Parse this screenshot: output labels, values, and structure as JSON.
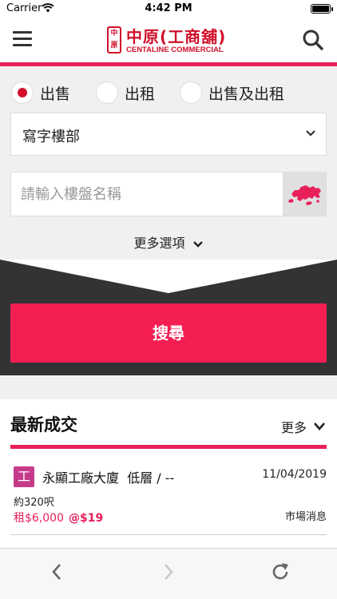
{
  "status_bar": {
    "carrier": "Carrier",
    "time": "4:42 PM"
  },
  "header": {
    "logo_seal": "中原",
    "logo_name_zh": "中原(工商舖)",
    "logo_name_en": "CENTALINE COMMERCIAL",
    "menu_icon": "hamburger-icon",
    "search_icon": "magnifier-icon",
    "accent_color": "#e8205a"
  },
  "search_form": {
    "radios": [
      {
        "label": "出售",
        "checked": true
      },
      {
        "label": "出租",
        "checked": false
      },
      {
        "label": "出售及出租",
        "checked": false
      }
    ],
    "property_type": "寫字樓部",
    "keyword_placeholder": "請輸入樓盤名稱",
    "map_icon": "hong-kong-map-icon",
    "more_options": "更多選項",
    "submit_label": "搜尋",
    "submit_color": "#f51e53"
  },
  "latest": {
    "title": "最新成交",
    "more_label": "更多",
    "transactions": [
      {
        "badge": "工",
        "name": "永顯工廠大廈",
        "floor": "低層",
        "unit": "/ --",
        "date": "11/04/2019",
        "area": "約320呎",
        "price": "租$6,000",
        "unit_price": "@$19",
        "source": "市場消息"
      }
    ]
  },
  "toolbar": {
    "back_icon": "chevron-left-icon",
    "forward_icon": "chevron-right-icon",
    "reload_icon": "reload-icon"
  }
}
